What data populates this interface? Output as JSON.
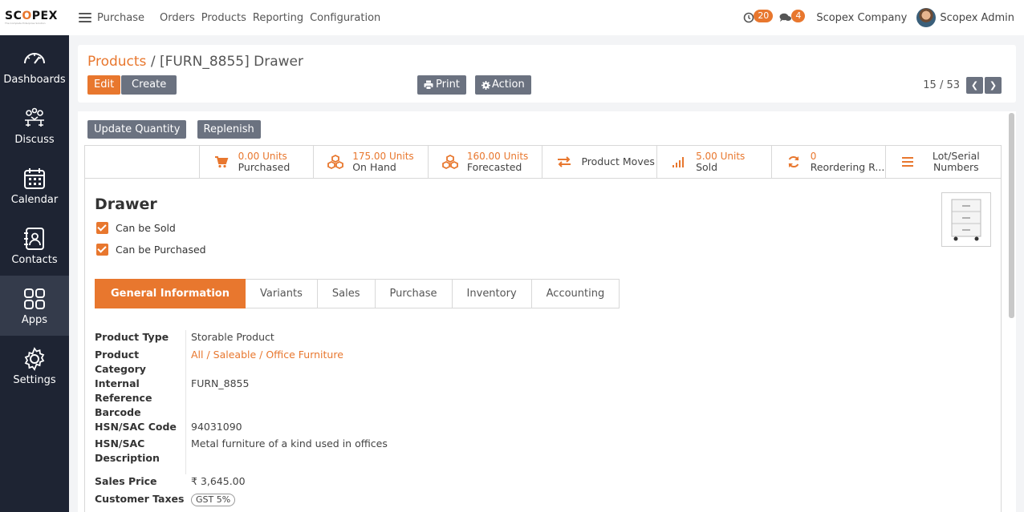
{
  "topbar": {
    "logo_brand_a": "SC",
    "logo_brand_b": "O",
    "logo_brand_c": "PEX",
    "logo_tagline": "The Complete Enterprise Solution",
    "app_name": "Purchase",
    "menu": [
      "Orders",
      "Products",
      "Reporting",
      "Configuration"
    ],
    "activity_count": "20",
    "message_count": "4",
    "company": "Scopex Company",
    "user": "Scopex Admin"
  },
  "sidebar": {
    "items": [
      {
        "label": "Dashboards",
        "icon": "gauge-icon"
      },
      {
        "label": "Discuss",
        "icon": "discuss-icon"
      },
      {
        "label": "Calendar",
        "icon": "calendar-icon"
      },
      {
        "label": "Contacts",
        "icon": "contacts-icon"
      },
      {
        "label": "Apps",
        "icon": "apps-grid-icon"
      },
      {
        "label": "Settings",
        "icon": "gear-icon"
      }
    ],
    "active": "Apps"
  },
  "control": {
    "breadcrumb_link": "Products",
    "breadcrumb_sep": "/",
    "breadcrumb_current": "[FURN_8855] Drawer",
    "edit": "Edit",
    "create": "Create",
    "print": "Print",
    "action": "Action",
    "pager": "15 / 53"
  },
  "status_buttons": {
    "update_quantity": "Update Quantity",
    "replenish": "Replenish"
  },
  "smart_buttons": [
    {
      "value": "0.00 Units",
      "label": "Purchased",
      "icon": "cart-icon"
    },
    {
      "value": "175.00 Units",
      "label": "On Hand",
      "icon": "cubes-icon"
    },
    {
      "value": "160.00 Units",
      "label": "Forecasted",
      "icon": "cubes-icon"
    },
    {
      "value": "",
      "label": "Product Moves",
      "icon": "exchange-icon"
    },
    {
      "value": "5.00 Units",
      "label": "Sold",
      "icon": "signal-icon"
    },
    {
      "value": "0",
      "label": "Reordering R...",
      "icon": "refresh-icon"
    },
    {
      "value": "",
      "label": "Lot/Serial Numbers",
      "icon": "bars-icon"
    }
  ],
  "product": {
    "name": "Drawer",
    "can_be_sold": "Can be Sold",
    "can_be_purchased": "Can be Purchased"
  },
  "tabs": [
    "General Information",
    "Variants",
    "Sales",
    "Purchase",
    "Inventory",
    "Accounting"
  ],
  "fields": {
    "product_type_label": "Product Type",
    "product_type": "Storable Product",
    "category_label_1": "Product",
    "category_label_2": "Category",
    "category": "All / Saleable / Office Furniture",
    "internal_ref_label_1": "Internal",
    "internal_ref_label_2": "Reference",
    "internal_ref": "FURN_8855",
    "barcode_label": "Barcode",
    "hsn_code_label": "HSN/SAC Code",
    "hsn_code": "94031090",
    "hsn_desc_label_1": "HSN/SAC",
    "hsn_desc_label_2": "Description",
    "hsn_desc": "Metal furniture of a kind used in offices",
    "sales_price_label": "Sales Price",
    "sales_price": "₹ 3,645.00",
    "customer_taxes_label": "Customer Taxes",
    "customer_taxes": "GST 5%"
  },
  "colors": {
    "accent": "#e8772e",
    "sidebar": "#1e2433",
    "button_gray": "#6b7280"
  }
}
